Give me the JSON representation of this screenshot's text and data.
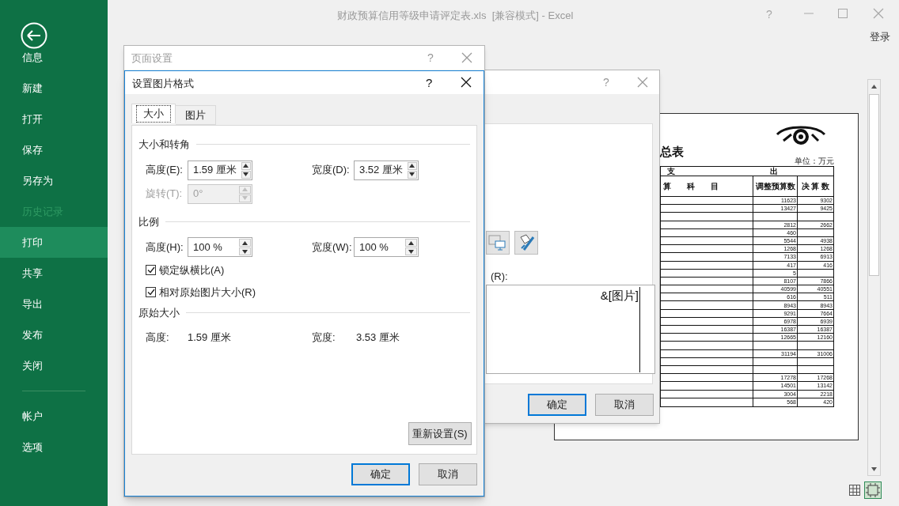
{
  "app": {
    "title": "财政预算信用等级申请评定表.xls  [兼容模式] - Excel",
    "help": "?",
    "sign_in": "登录"
  },
  "backstage": {
    "items": [
      {
        "label": "信息",
        "selected": false,
        "disabled": false
      },
      {
        "label": "新建",
        "selected": false,
        "disabled": false
      },
      {
        "label": "打开",
        "selected": false,
        "disabled": false
      },
      {
        "label": "保存",
        "selected": false,
        "disabled": false
      },
      {
        "label": "另存为",
        "selected": false,
        "disabled": false
      },
      {
        "label": "历史记录",
        "selected": false,
        "disabled": true
      },
      {
        "label": "打印",
        "selected": true,
        "disabled": false
      },
      {
        "label": "共享",
        "selected": false,
        "disabled": false
      },
      {
        "label": "导出",
        "selected": false,
        "disabled": false
      },
      {
        "label": "发布",
        "selected": false,
        "disabled": false
      },
      {
        "label": "关闭",
        "selected": false,
        "disabled": false
      }
    ],
    "footer_items": [
      {
        "label": "帐户",
        "selected": false,
        "disabled": false
      },
      {
        "label": "选项",
        "selected": false,
        "disabled": false
      }
    ]
  },
  "preview": {
    "title": "总表",
    "unit": "单位：万元",
    "group_header": [
      "支",
      "出"
    ],
    "columns": [
      "算　　科　　目",
      "调整预算数",
      "决 算 数"
    ],
    "rows": [
      {
        "kind": "data",
        "budget": "11623",
        "final": "9302"
      },
      {
        "kind": "data",
        "budget": "13427",
        "final": "9425"
      },
      {
        "kind": "blank"
      },
      {
        "kind": "data",
        "budget": "2812",
        "final": "2662"
      },
      {
        "kind": "data",
        "budget": "460"
      },
      {
        "kind": "data",
        "budget": "5544",
        "final": "4938"
      },
      {
        "kind": "data",
        "budget": "1268",
        "final": "1268"
      },
      {
        "kind": "data",
        "budget": "7133",
        "final": "6913"
      },
      {
        "kind": "data",
        "budget": "417",
        "final": "416"
      },
      {
        "kind": "data",
        "budget": "5"
      },
      {
        "kind": "data",
        "budget": "8107",
        "final": "7866"
      },
      {
        "kind": "data",
        "budget": "40599",
        "final": "40551"
      },
      {
        "kind": "data",
        "budget": "616",
        "final": "511"
      },
      {
        "kind": "data",
        "budget": "8943",
        "final": "8943"
      },
      {
        "kind": "data",
        "budget": "9291",
        "final": "7664"
      },
      {
        "kind": "data",
        "budget": "6978",
        "final": "6939"
      },
      {
        "kind": "data",
        "budget": "16387",
        "final": "16387"
      },
      {
        "kind": "data",
        "budget": "12665",
        "final": "12160"
      },
      {
        "kind": "blank"
      },
      {
        "kind": "data",
        "budget": "31194",
        "final": "31006"
      },
      {
        "kind": "blank"
      },
      {
        "kind": "blank"
      },
      {
        "kind": "data",
        "budget": "17278",
        "final": "17268"
      },
      {
        "kind": "data",
        "budget": "14501",
        "final": "13142"
      },
      {
        "kind": "data",
        "budget": "3004",
        "final": "2218"
      },
      {
        "kind": "data",
        "budget": "568",
        "final": "420"
      }
    ]
  },
  "page_setup_dialog": {
    "title": "页面设置",
    "help": "?"
  },
  "header_dialog": {
    "help": "?",
    "label": "(R):",
    "content": "&[图片]",
    "buttons": [
      {
        "label": "确定",
        "default": true
      },
      {
        "label": "取消",
        "default": false
      }
    ]
  },
  "format_dialog": {
    "title": "设置图片格式",
    "help": "?",
    "tabs": [
      {
        "label": "大小",
        "selected": true
      },
      {
        "label": "图片",
        "selected": false
      }
    ],
    "size_rotate": {
      "title": "大小和转角",
      "height": {
        "label": "高度(E):",
        "value": "1.59 厘米",
        "disabled": false
      },
      "width": {
        "label": "宽度(D):",
        "value": "3.52 厘米",
        "disabled": false
      },
      "rotation": {
        "label": "旋转(T):",
        "value": "0°",
        "disabled": true
      }
    },
    "scale": {
      "title": "比例",
      "height": {
        "label": "高度(H):",
        "value": "100 %",
        "disabled": false
      },
      "width": {
        "label": "宽度(W):",
        "value": "100 %",
        "disabled": false
      },
      "checkboxes": [
        {
          "label": "锁定纵横比(A)",
          "checked": true
        },
        {
          "label": "相对原始图片大小(R)",
          "checked": true
        }
      ]
    },
    "original": {
      "title": "原始大小",
      "height_label": "高度:",
      "height": "1.59 厘米",
      "width_label": "宽度:",
      "width": "3.53 厘米"
    },
    "reset_button": "重新设置(S)",
    "buttons": [
      {
        "label": "确定",
        "default": true
      },
      {
        "label": "取消",
        "default": false
      }
    ]
  }
}
